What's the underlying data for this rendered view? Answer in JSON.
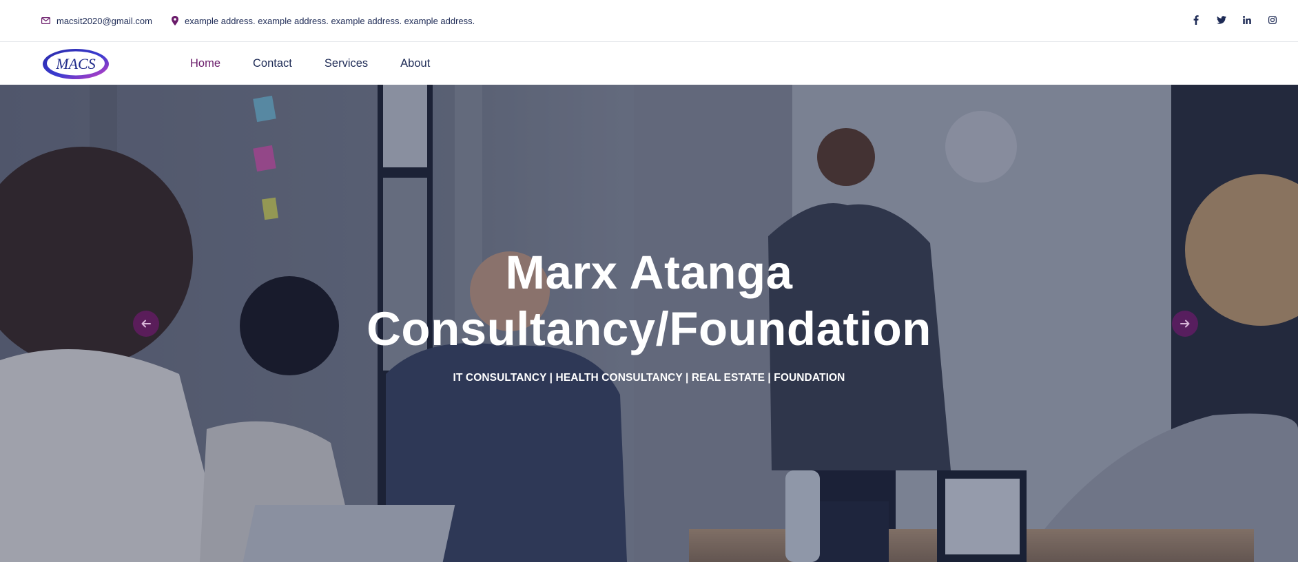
{
  "topbar": {
    "email": "macsit2020@gmail.com",
    "address": "example address. example address. example address. example address.",
    "social_icons": [
      "facebook-icon",
      "twitter-icon",
      "linkedin-icon",
      "instagram-icon"
    ]
  },
  "navbar": {
    "logo_text": "MACS",
    "links": [
      {
        "label": "Home",
        "active": true
      },
      {
        "label": "Contact",
        "active": false
      },
      {
        "label": "Services",
        "active": false
      },
      {
        "label": "About",
        "active": false
      }
    ]
  },
  "hero": {
    "title_line1": "Marx Atanga",
    "title_line2": "Consultancy/Foundation",
    "subtitle": "IT CONSULTANCY | HEALTH CONSULTANCY | REAL ESTATE | FOUNDATION",
    "prev_icon": "arrow-left-icon",
    "next_icon": "arrow-right-icon"
  },
  "colors": {
    "brand_purple": "#6a1b6a",
    "navy_text": "#1d2a55",
    "hero_overlay": "#162046"
  }
}
